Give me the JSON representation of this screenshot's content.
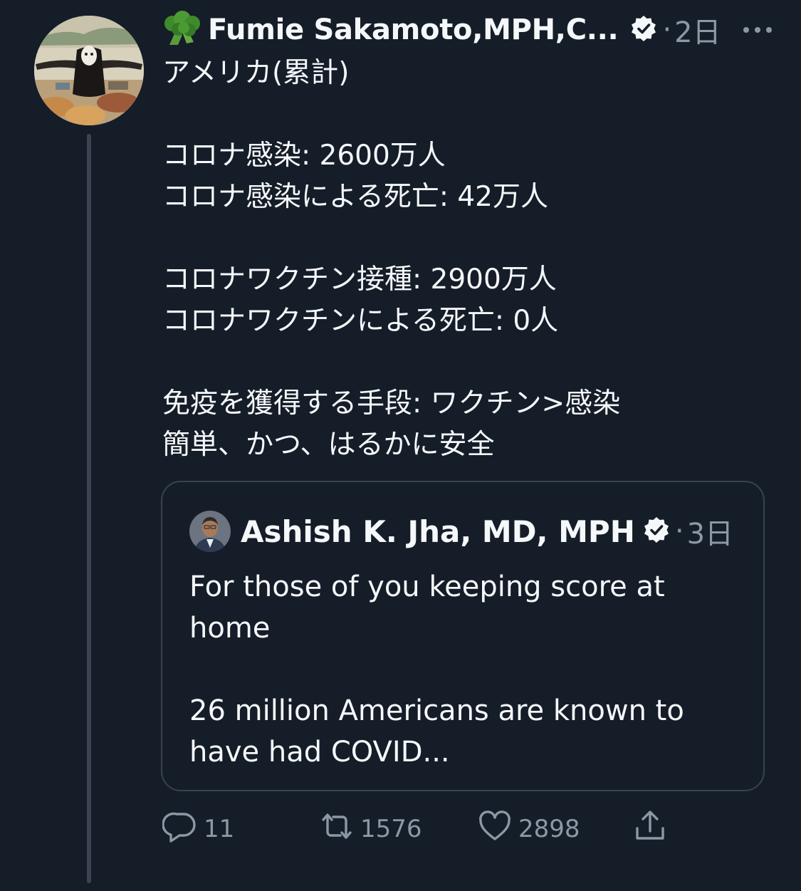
{
  "tweet": {
    "author_name": "Fumie Sakamoto,MPH,C...",
    "author_emoji": "broccoli",
    "time": "2日",
    "dot": "·",
    "lines": [
      "アメリカ(累計)",
      "",
      "コロナ感染: 2600万人",
      "コロナ感染による死亡: 42万人",
      "",
      "コロナワクチン接種: 2900万人",
      "コロナワクチンによる死亡: 0人",
      "",
      "免疫を獲得する手段: ワクチン>感染",
      "簡単、かつ、はるかに安全"
    ]
  },
  "quoted": {
    "author_name": "Ashish K. Jha, MD, MPH",
    "time": "3日",
    "dot": "·",
    "lines": [
      "For those of you keeping score at",
      "home",
      "",
      "26 million Americans are known to",
      "have had COVID..."
    ]
  },
  "actions": {
    "reply_count": "11",
    "retweet_count": "1576",
    "like_count": "2898"
  },
  "colors": {
    "background": "#151d28",
    "text": "#f5f8fa",
    "secondary": "#8b98a5",
    "border": "#38434f"
  },
  "icons": [
    "more-icon",
    "verified-icon",
    "reply-icon",
    "retweet-icon",
    "like-icon",
    "share-icon"
  ]
}
